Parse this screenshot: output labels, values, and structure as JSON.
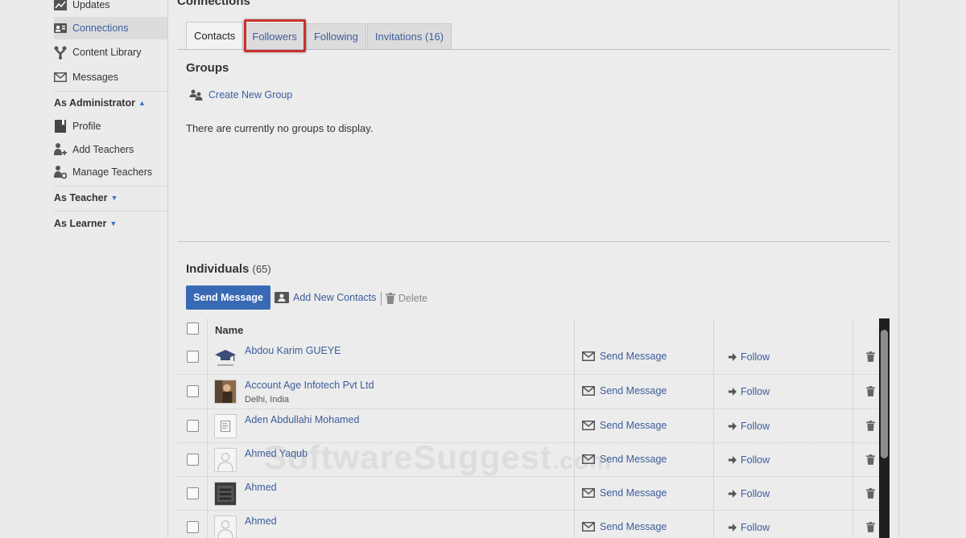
{
  "sidebar": {
    "items": [
      {
        "label": "Updates",
        "icon": "chart-icon"
      },
      {
        "label": "Connections",
        "icon": "contacts-card-icon",
        "active": true
      },
      {
        "label": "Content Library",
        "icon": "library-fork-icon"
      },
      {
        "label": "Messages",
        "icon": "envelope-icon"
      }
    ],
    "admin_header": "As Administrator",
    "admin_items": [
      {
        "label": "Profile",
        "icon": "book-icon"
      },
      {
        "label": "Add Teachers",
        "icon": "user-add-icon"
      },
      {
        "label": "Manage Teachers",
        "icon": "user-gear-icon"
      }
    ],
    "teacher_header": "As Teacher",
    "learner_header": "As Learner",
    "caret_up": "▲",
    "caret_down": "▼"
  },
  "main": {
    "title": "Connections",
    "tabs": [
      {
        "label": "Contacts",
        "active": true
      },
      {
        "label": "Followers"
      },
      {
        "label": "Following"
      },
      {
        "label": "Invitations (16)"
      }
    ],
    "groups": {
      "title": "Groups",
      "create_label": "Create New Group",
      "empty_text": "There are currently no groups to display."
    },
    "individuals": {
      "title": "Individuals",
      "count": "(65)",
      "send_message_btn": "Send Message",
      "add_contacts_label": "Add New Contacts",
      "delete_label": "Delete",
      "name_header": "Name",
      "row_send_label": "Send Message",
      "row_follow_label": "Follow",
      "rows": [
        {
          "name": "Abdou Karim GUEYE",
          "location": "",
          "avatar": "graduation-cap-icon"
        },
        {
          "name": "Account Age Infotech Pvt Ltd",
          "location": "Delhi, India",
          "avatar": "photo-icon"
        },
        {
          "name": "Aden Abdullahi Mohamed",
          "location": "",
          "avatar": "document-icon"
        },
        {
          "name": "Ahmed Yaqub",
          "location": "",
          "avatar": "silhouette-icon"
        },
        {
          "name": "Ahmed",
          "location": "",
          "avatar": "photo-dark-icon"
        },
        {
          "name": "Ahmed",
          "location": "",
          "avatar": "silhouette-icon"
        }
      ]
    }
  },
  "watermark": {
    "text": "SoftwareSuggest",
    "suffix": ".com"
  },
  "colors": {
    "accent": "#3869b4",
    "link": "#3b5d9c",
    "highlight": "#c9312b"
  }
}
